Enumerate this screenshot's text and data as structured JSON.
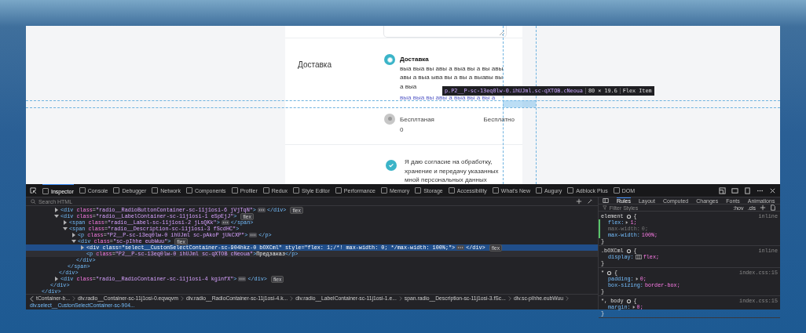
{
  "page": {
    "section_label": "Доставка",
    "options": [
      {
        "title": "Доставка",
        "description": "выа выа вы авы а выа вы а вы авы авы а выа ыва вы а вы а выавы вы а выа",
        "note": "выа выа вы авы а выа вы а вы а",
        "selected": true
      },
      {
        "title": "Бесплтаная 0",
        "price": "Бесплатно",
        "selected": false
      }
    ],
    "consent": {
      "text": "Я даю согласие на обработку, хранение и передачу указанных мной персональных данных",
      "checked": true
    }
  },
  "highlight": {
    "selector": "p.P2__P-sc-13eq0lw-0.ihUJml.sc-qXTOB.cNeoua",
    "size": "80 × 19.6",
    "kind": "Flex Item"
  },
  "devtools": {
    "tabs": [
      {
        "label": "Inspector",
        "selected": true
      },
      {
        "label": "Console",
        "selected": false
      },
      {
        "label": "Debugger",
        "selected": false
      },
      {
        "label": "Network",
        "selected": false
      },
      {
        "label": "Components",
        "selected": false
      },
      {
        "label": "Profiler",
        "selected": false
      },
      {
        "label": "Redux",
        "selected": false
      },
      {
        "label": "Style Editor",
        "selected": false
      },
      {
        "label": "Performance",
        "selected": false
      },
      {
        "label": "Memory",
        "selected": false
      },
      {
        "label": "Storage",
        "selected": false
      },
      {
        "label": "Accessibility",
        "selected": false
      },
      {
        "label": "What's New",
        "selected": false
      },
      {
        "label": "Augury",
        "selected": false
      },
      {
        "label": "Adblock Plus",
        "selected": false
      },
      {
        "label": "DOM",
        "selected": false
      }
    ],
    "search": {
      "placeholder": "Search HTML"
    },
    "tree": [
      {
        "close": "</div>",
        "children": [
          {
            "close": "</div>",
            "children": [
              {
                "open": "<div class=\"radio__RadioButtonContainer-sc-11j1osi-6 jVjTqN\">",
                "end": "</div>",
                "expanded": false,
                "badge": "flex",
                "selected": false,
                "hovered": false
              },
              {
                "open": "<div class=\"radio__LabelContainer-sc-11j1osi-1 eSpEjJ\">",
                "close": "</div>",
                "expanded": true,
                "badge": "flex",
                "selected": false,
                "hovered": false,
                "children": [
                  {
                    "open": "<span class=\"radio__Label-sc-11j1osi-2 jLsQKk\">",
                    "end": "</span>",
                    "expanded": false,
                    "selected": false,
                    "hovered": false
                  },
                  {
                    "open": "<span class=\"radio__Description-sc-11j1osi-3 fScdHC\">",
                    "close": "</span>",
                    "expanded": true,
                    "selected": false,
                    "hovered": false,
                    "children": [
                      {
                        "open": "<p class=\"P2__P-sc-13eq0lw-0 ihUJml sc-pAkoP jUkCXP\">",
                        "end": "</p>",
                        "expanded": false,
                        "selected": false,
                        "hovered": false
                      },
                      {
                        "open": "<div class=\"sc-pIhhe eubWuu\">",
                        "close": "</div>",
                        "expanded": true,
                        "badge": "flex",
                        "selected": false,
                        "hovered": false,
                        "children": [
                          {
                            "open": "<div class=\"select__CustonSelectContainer-sc-904hkz-0 bOXCml\" style=\"flex: 1;/*! max-width: 0; */max-width: 100%;\">",
                            "end": "</div>",
                            "expanded": false,
                            "badge": "flex",
                            "selected": true,
                            "hovered": false
                          },
                          {
                            "open": "<p class=\"P2__P-sc-13eq0lw-0 ihUJml sc-qXTOB cNeoua\">",
                            "text": "Предзаказ",
                            "end": "</p>",
                            "selected": false,
                            "hovered": true
                          }
                        ]
                      }
                    ]
                  }
                ]
              },
              {
                "open": "<div class=\"radio__RadioContainer-sc-11j1osi-4 kginfX\">",
                "end": "</div>",
                "expanded": false,
                "badge": "flex",
                "selected": false,
                "hovered": false
              }
            ]
          }
        ]
      }
    ],
    "breadcrumbs": [
      {
        "label": "tContainer-b...",
        "selected": false
      },
      {
        "label": "div.radio__Container-sc-11j1osi-0.eqwqvm",
        "selected": false
      },
      {
        "label": "div.radio__RadioContainer-sc-11j1osi-4.k...",
        "selected": false
      },
      {
        "label": "div.radio__LabelContainer-sc-11j1osi-1.e...",
        "selected": false
      },
      {
        "label": "span.radio__Description-sc-11j1osi-3.fSc...",
        "selected": false
      },
      {
        "label": "div.sc-pIhhe.eubWuu",
        "selected": false
      },
      {
        "label": "div.select__CustonSelectContainer-sc-904...",
        "selected": true
      }
    ],
    "side_tabs": [
      {
        "label": "Rules",
        "selected": true
      },
      {
        "label": "Layout",
        "selected": false
      },
      {
        "label": "Computed",
        "selected": false
      },
      {
        "label": "Changes",
        "selected": false
      },
      {
        "label": "Fonts",
        "selected": false
      },
      {
        "label": "Animations",
        "selected": false
      }
    ],
    "filter": {
      "placeholder": "Filter Styles",
      "buttons": [
        ":hov",
        ".cls"
      ]
    },
    "rules": [
      {
        "selector": "element",
        "open_brace": "{",
        "close_brace": "}",
        "source": "inline",
        "declarations": [
          {
            "prop": "flex:",
            "value": "1;",
            "expandable": true,
            "changed": true,
            "disabled": false
          },
          {
            "prop": "max-width:",
            "value": "0;",
            "expandable": false,
            "changed": true,
            "disabled": true
          },
          {
            "prop": "max-width:",
            "value": "100%;",
            "expandable": false,
            "changed": true,
            "disabled": false
          }
        ]
      },
      {
        "selector": ".bOXCml",
        "open_brace": "{",
        "close_brace": "}",
        "source": "inline",
        "declarations": [
          {
            "prop": "display:",
            "value": "flex;",
            "expandable": false,
            "changed": false,
            "disabled": false,
            "flex_badge": true
          }
        ]
      },
      {
        "selector": "*",
        "open_brace": "{",
        "close_brace": "}",
        "source": "index.css:15",
        "declarations": [
          {
            "prop": "padding:",
            "value": "0;",
            "expandable": true,
            "changed": false,
            "disabled": false
          },
          {
            "prop": "box-sizing:",
            "value": "border-box;",
            "expandable": false,
            "changed": false,
            "disabled": false
          }
        ]
      },
      {
        "selector": "*, body",
        "open_brace": "{",
        "close_brace": "}",
        "source": "index.css:15",
        "declarations": [
          {
            "prop": "margin:",
            "value": "0;",
            "expandable": true,
            "changed": false,
            "disabled": false
          }
        ]
      }
    ]
  }
}
